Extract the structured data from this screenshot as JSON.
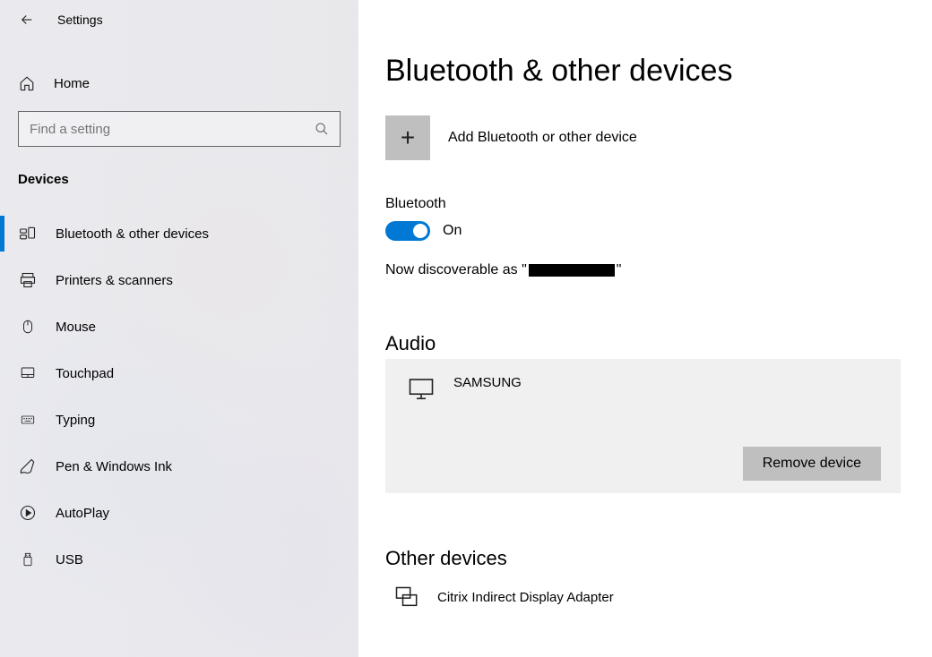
{
  "header": {
    "title": "Settings"
  },
  "home": {
    "label": "Home"
  },
  "search": {
    "placeholder": "Find a setting"
  },
  "section": {
    "heading": "Devices"
  },
  "nav": {
    "items": [
      {
        "label": "Bluetooth & other devices"
      },
      {
        "label": "Printers & scanners"
      },
      {
        "label": "Mouse"
      },
      {
        "label": "Touchpad"
      },
      {
        "label": "Typing"
      },
      {
        "label": "Pen & Windows Ink"
      },
      {
        "label": "AutoPlay"
      },
      {
        "label": "USB"
      }
    ]
  },
  "main": {
    "title": "Bluetooth & other devices",
    "add_label": "Add Bluetooth or other device",
    "bluetooth_label": "Bluetooth",
    "toggle_state": "On",
    "discover_prefix": "Now discoverable as \"",
    "discover_suffix": "\"",
    "audio_heading": "Audio",
    "audio_device": "SAMSUNG",
    "remove_label": "Remove device",
    "other_heading": "Other devices",
    "other_device": "Citrix Indirect Display Adapter"
  }
}
